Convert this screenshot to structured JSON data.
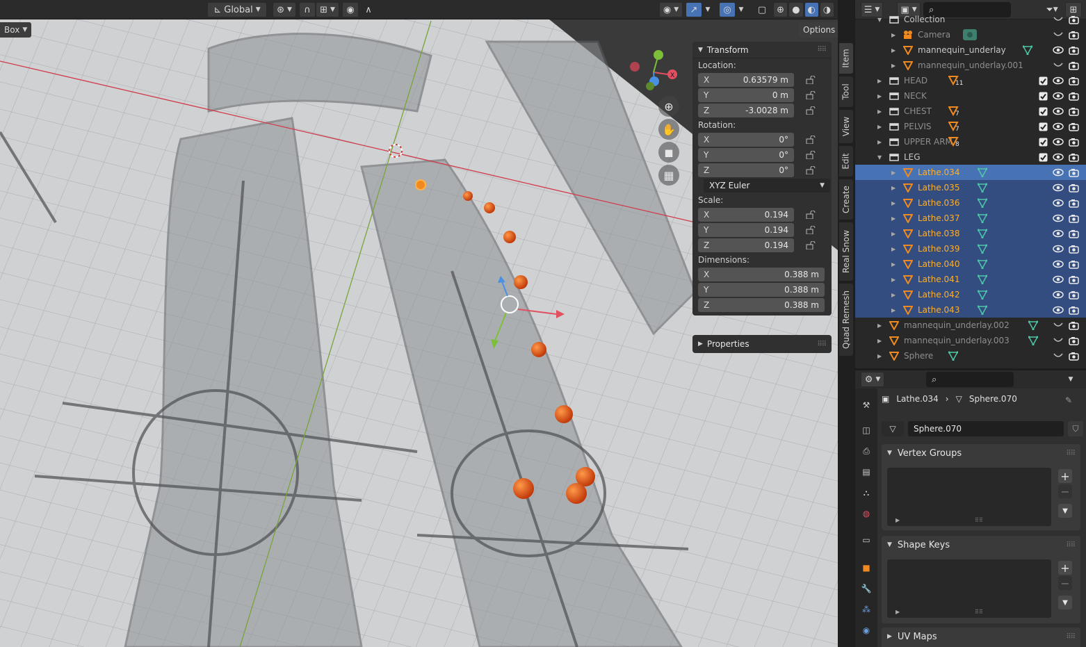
{
  "viewport": {
    "orientation": "Global",
    "select_mode": "Box",
    "options_label": "Options"
  },
  "npanel": {
    "transform_title": "Transform",
    "location_label": "Location:",
    "location": [
      {
        "axis": "X",
        "value": "0.63579 m"
      },
      {
        "axis": "Y",
        "value": "0 m"
      },
      {
        "axis": "Z",
        "value": "-3.0028 m"
      }
    ],
    "rotation_label": "Rotation:",
    "rotation": [
      {
        "axis": "X",
        "value": "0°"
      },
      {
        "axis": "Y",
        "value": "0°"
      },
      {
        "axis": "Z",
        "value": "0°"
      }
    ],
    "rotation_mode": "XYZ Euler",
    "scale_label": "Scale:",
    "scale": [
      {
        "axis": "X",
        "value": "0.194"
      },
      {
        "axis": "Y",
        "value": "0.194"
      },
      {
        "axis": "Z",
        "value": "0.194"
      }
    ],
    "dimensions_label": "Dimensions:",
    "dimensions": [
      {
        "axis": "X",
        "value": "0.388 m"
      },
      {
        "axis": "Y",
        "value": "0.388 m"
      },
      {
        "axis": "Z",
        "value": "0.388 m"
      }
    ],
    "properties_title": "Properties"
  },
  "side_tabs": [
    "Item",
    "Tool",
    "View",
    "Edit",
    "Create",
    "Real Snow",
    "Quad Remesh"
  ],
  "outliner": {
    "rows": [
      {
        "name": "Collection",
        "type": "collection",
        "state": "normal"
      },
      {
        "name": "Camera",
        "type": "camera",
        "state": "muted"
      },
      {
        "name": "mannequin_underlay",
        "type": "mesh",
        "state": "normal"
      },
      {
        "name": "mannequin_underlay.001",
        "type": "mesh",
        "state": "muted"
      },
      {
        "name": "HEAD",
        "type": "collection",
        "state": "muted",
        "badge": "11"
      },
      {
        "name": "NECK",
        "type": "collection",
        "state": "muted"
      },
      {
        "name": "CHEST",
        "type": "collection",
        "state": "muted",
        "badge": "7"
      },
      {
        "name": "PELVIS",
        "type": "collection",
        "state": "muted",
        "badge": "7"
      },
      {
        "name": "UPPER ARM",
        "type": "collection",
        "state": "muted",
        "badge": "8"
      },
      {
        "name": "LEG",
        "type": "collection",
        "state": "normal"
      },
      {
        "name": "Lathe.034",
        "type": "mesh",
        "state": "active"
      },
      {
        "name": "Lathe.035",
        "type": "mesh",
        "state": "selected"
      },
      {
        "name": "Lathe.036",
        "type": "mesh",
        "state": "selected"
      },
      {
        "name": "Lathe.037",
        "type": "mesh",
        "state": "selected"
      },
      {
        "name": "Lathe.038",
        "type": "mesh",
        "state": "selected"
      },
      {
        "name": "Lathe.039",
        "type": "mesh",
        "state": "selected"
      },
      {
        "name": "Lathe.040",
        "type": "mesh",
        "state": "selected"
      },
      {
        "name": "Lathe.041",
        "type": "mesh",
        "state": "selected"
      },
      {
        "name": "Lathe.042",
        "type": "mesh",
        "state": "selected"
      },
      {
        "name": "Lathe.043",
        "type": "mesh",
        "state": "selected"
      },
      {
        "name": "mannequin_underlay.002",
        "type": "mesh",
        "state": "muted"
      },
      {
        "name": "mannequin_underlay.003",
        "type": "mesh",
        "state": "muted"
      },
      {
        "name": "Sphere",
        "type": "mesh",
        "state": "muted"
      }
    ]
  },
  "properties": {
    "breadcrumb_object": "Lathe.034",
    "breadcrumb_mesh": "Sphere.070",
    "mesh_name": "Sphere.070",
    "panels": [
      "Vertex Groups",
      "Shape Keys",
      "UV Maps"
    ]
  },
  "colors": {
    "accent_orange": "#ffaf29",
    "selection_blue": "#334d80",
    "active_blue": "#4772b3",
    "mesh_green": "#4ec7a8"
  }
}
